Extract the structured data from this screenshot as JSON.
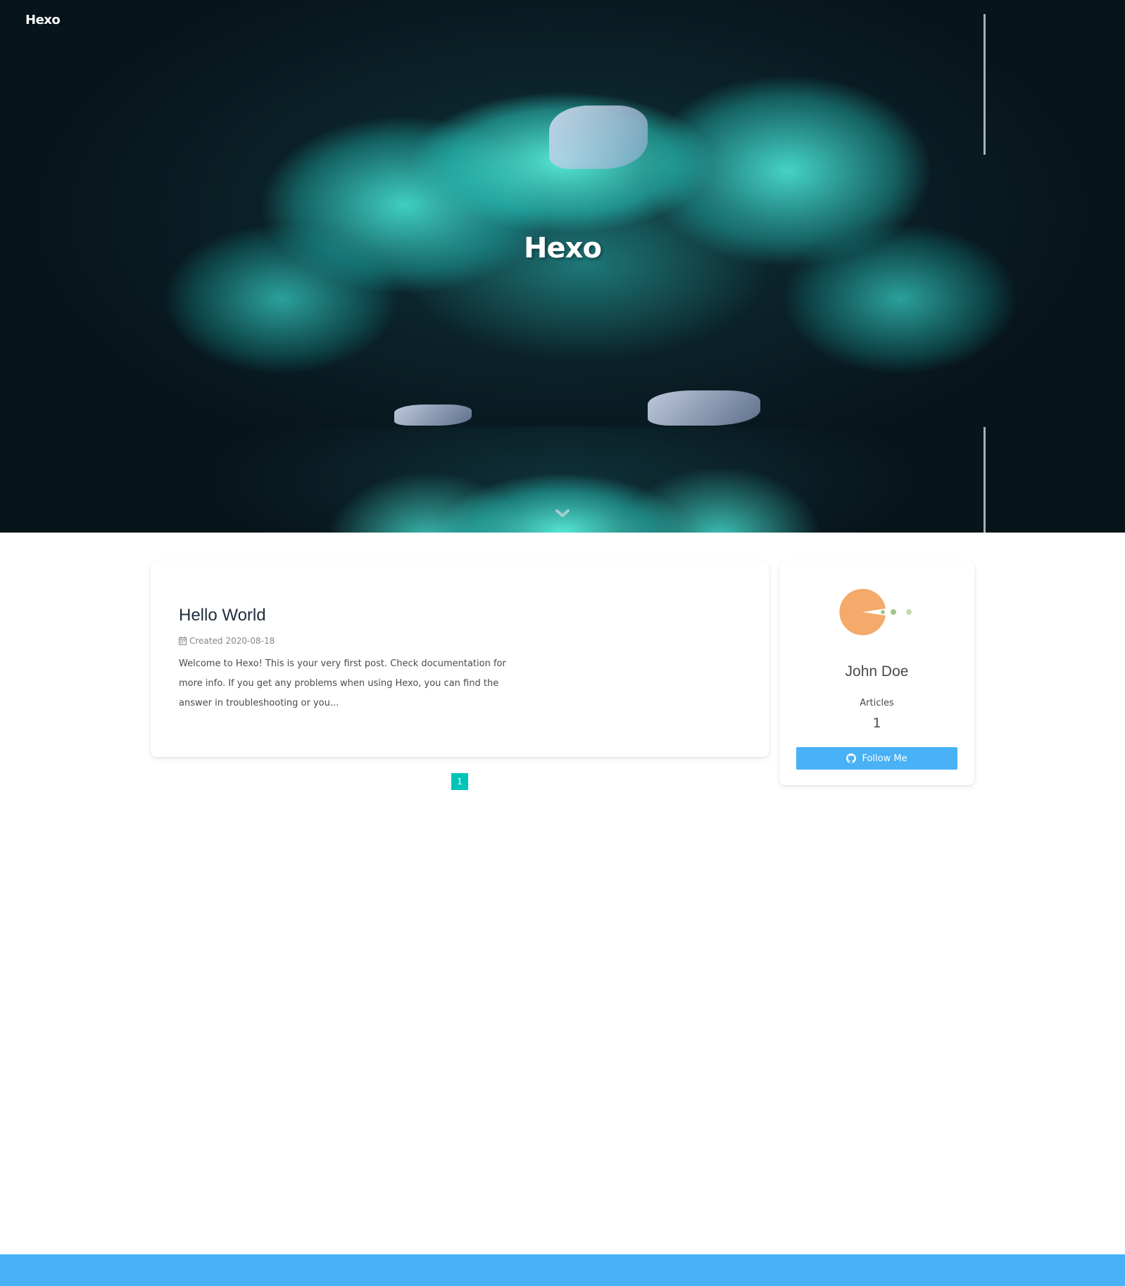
{
  "nav": {
    "site_name": "Hexo"
  },
  "hero": {
    "title": "Hexo",
    "scroll_icon": "chevron-down-icon"
  },
  "post": {
    "title": "Hello World",
    "meta_icon": "calendar-icon",
    "meta_label": "Created",
    "date": "2020-08-18",
    "excerpt": "Welcome to Hexo! This is your very first post. Check documentation for more info. If you get any problems when using Hexo, you can find the answer in troubleshooting or you..."
  },
  "pagination": {
    "current_page": "1"
  },
  "profile": {
    "author": "John Doe",
    "articles_label": "Articles",
    "articles_count": "1",
    "follow_label": "Follow Me",
    "follow_icon": "github-icon"
  },
  "colors": {
    "accent": "#49b1f5",
    "pagination": "#00c4b6",
    "avatar": "#f5a96a",
    "avatar_dots": "#a3c48a"
  }
}
